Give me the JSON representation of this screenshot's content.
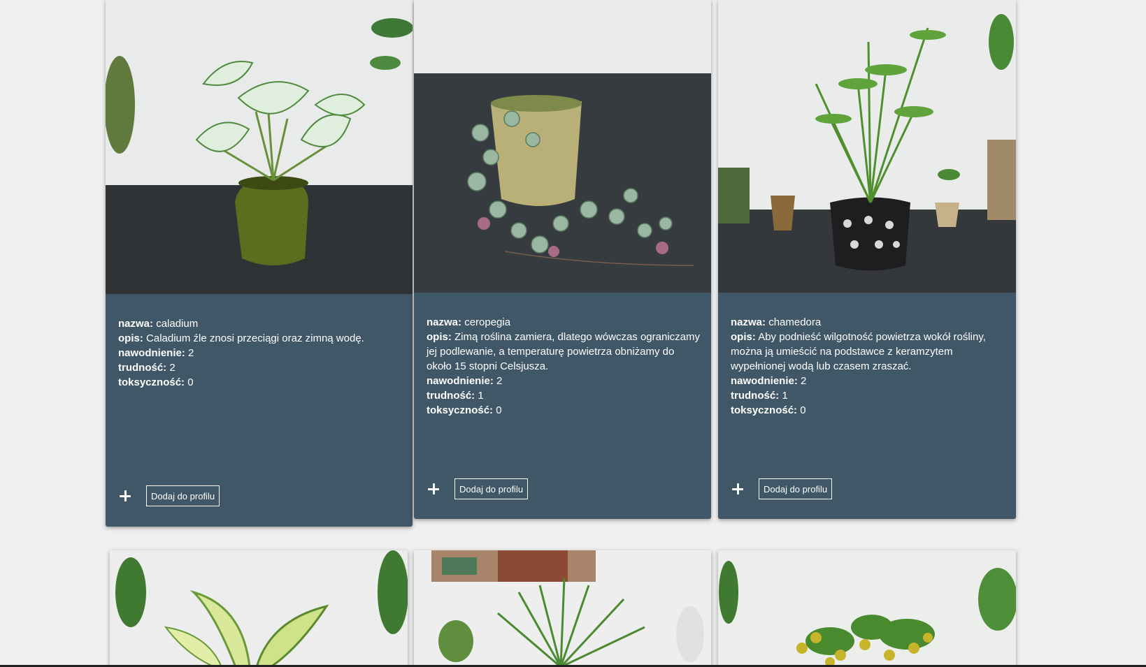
{
  "labels": {
    "name": "nazwa:",
    "description": "opis:",
    "watering": "nawodnienie:",
    "difficulty": "trudność:",
    "toxicity": "toksyczność:"
  },
  "add_button_label": "Dodaj do profilu",
  "plants": [
    {
      "name": "caladium",
      "description": "Caladium źle znosi przeciągi oraz zimną wodę.",
      "watering": "2",
      "difficulty": "2",
      "toxicity": "0"
    },
    {
      "name": "ceropegia",
      "description": "Zimą roślina zamiera, dlatego wówczas ograniczamy jej podlewanie, a temperaturę powietrza obniżamy do około 15 stopni Celsjusza.",
      "watering": "2",
      "difficulty": "1",
      "toxicity": "0"
    },
    {
      "name": "chamedora",
      "description": "Aby podnieść wilgotność powietrza wokół rośliny, można ją umieścić na podstawce z keramzytem wypełnionej wodą lub czasem zraszać.",
      "watering": "2",
      "difficulty": "1",
      "toxicity": "0"
    }
  ],
  "colors": {
    "card_background": "#3f5767",
    "page_background": "#efefef",
    "text": "#ffffff"
  }
}
